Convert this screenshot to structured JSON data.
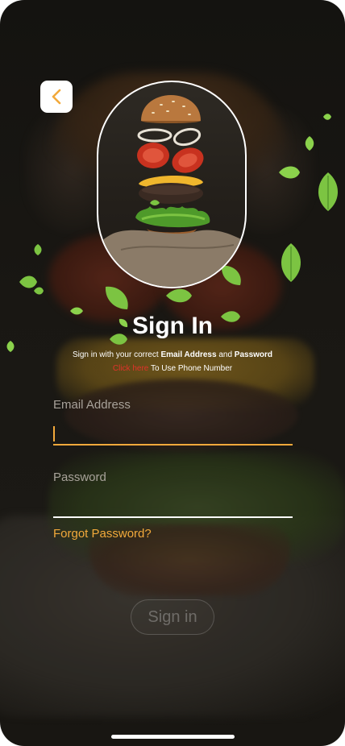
{
  "screen": {
    "title": "Sign In",
    "subtitle_prefix": "Sign in with your correct ",
    "subtitle_email": "Email Address",
    "subtitle_and": " and ",
    "subtitle_password": "Password",
    "phone_link": "Click here",
    "phone_rest": " To Use Phone Number"
  },
  "form": {
    "email_label": "Email Address",
    "email_value": "",
    "password_label": "Password",
    "password_value": "",
    "forgot_label": "Forgot Password?",
    "submit_label": "Sign in"
  },
  "icons": {
    "back": "chevron-left-icon",
    "leaf": "leaf-icon"
  },
  "colors": {
    "accent": "#f2a93b",
    "link": "#e0332a",
    "background": "#171511",
    "text": "#ffffff",
    "muted": "#a8a29a"
  }
}
